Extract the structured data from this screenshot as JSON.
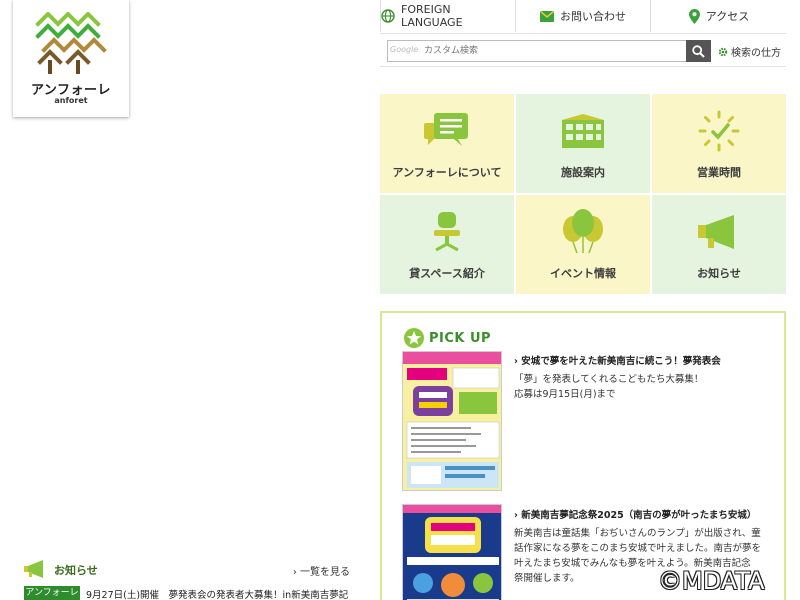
{
  "logo": {
    "name_ja": "アンフォーレ",
    "name_en": "anforet"
  },
  "top_links": [
    {
      "label": "FOREIGN LANGUAGE",
      "icon": "globe-icon"
    },
    {
      "label": "お問い合わせ",
      "icon": "mail-icon"
    },
    {
      "label": "アクセス",
      "icon": "map-pin-icon"
    }
  ],
  "search": {
    "google_label": "Google",
    "placeholder": "カスタム検索",
    "help_label": "検索の仕方"
  },
  "tiles": [
    {
      "label": "アンフォーレについて",
      "icon": "speech-bubble-icon"
    },
    {
      "label": "施設案内",
      "icon": "building-icon"
    },
    {
      "label": "営業時間",
      "icon": "clock-icon"
    },
    {
      "label": "貸スペース紹介",
      "icon": "chair-icon"
    },
    {
      "label": "イベント情報",
      "icon": "balloons-icon"
    },
    {
      "label": "お知らせ",
      "icon": "megaphone-icon"
    }
  ],
  "pickup": {
    "title": "PICK UP",
    "items": [
      {
        "title": "安城で夢を叶えた新美南吉に続こう！夢発表会",
        "body_lines": [
          "「夢」を発表してくれるこどもたち大募集！",
          "応募は9月15日(月)まで"
        ]
      },
      {
        "title": "新美南吉夢記念祭2025（南吉の夢が叶ったまち安城）",
        "body_lines": [
          "新美南吉は童話集「おぢいさんのランプ」が出版され、童",
          "話作家になる夢をこのまち安城で叶えました。南吉が夢を",
          "叶えたまち安城でみんなも夢を叶えよう。新美南吉記念",
          "祭開催します。"
        ]
      }
    ]
  },
  "news": {
    "title": "お知らせ",
    "more_label": "一覧を見る",
    "items": [
      {
        "badge": "アンフォーレ",
        "text": "9月27日(土)開催　夢発表会の発表者大募集！in新美南吉夢記"
      }
    ]
  },
  "watermark": "©MDATA",
  "colors": {
    "brand_green": "#3a8f2a",
    "tile_yellow": "#faf6c8",
    "tile_green": "#e5f4df",
    "icon_green": "#8ac53e",
    "icon_yellow": "#c8c832"
  }
}
